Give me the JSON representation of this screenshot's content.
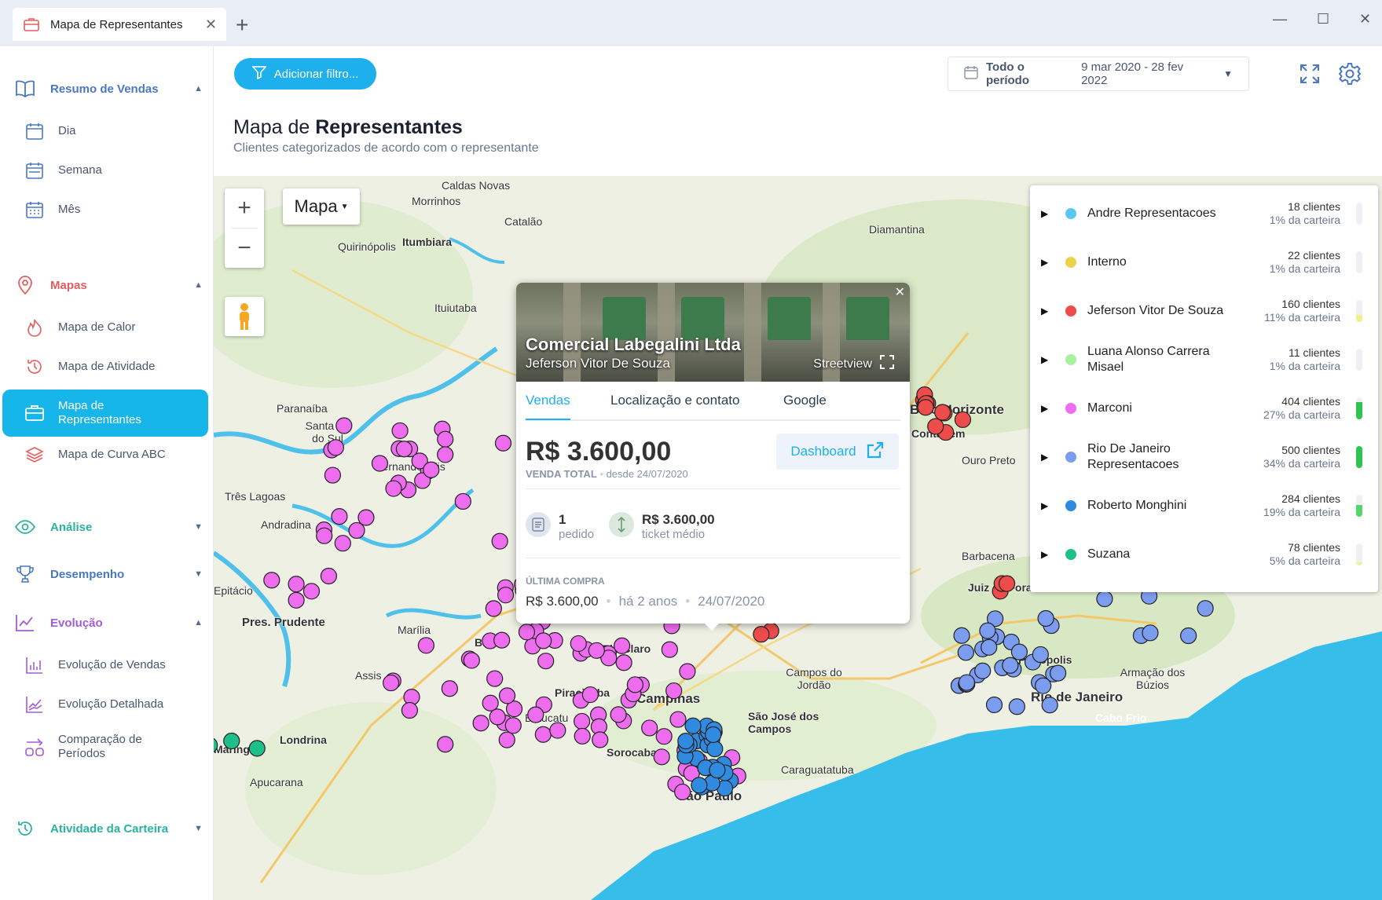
{
  "tab": {
    "title": "Mapa de Representantes",
    "icon": "briefcase-icon"
  },
  "sidebar": {
    "sections": [
      {
        "label": "Resumo de Vendas",
        "icon": "book-icon",
        "color": "#4a78c2",
        "expanded": true,
        "items": [
          {
            "label": "Dia",
            "icon": "calendar-day-icon"
          },
          {
            "label": "Semana",
            "icon": "calendar-week-icon"
          },
          {
            "label": "Mês",
            "icon": "calendar-month-icon"
          }
        ]
      },
      {
        "label": "Mapas",
        "icon": "map-pin-icon",
        "color": "#e85d5d",
        "expanded": true,
        "items": [
          {
            "label": "Mapa de Calor",
            "icon": "flame-icon"
          },
          {
            "label": "Mapa de Atividade",
            "icon": "history-icon"
          },
          {
            "label": "Mapa de Representantes",
            "icon": "briefcase-icon",
            "active": true
          },
          {
            "label": "Mapa de Curva ABC",
            "icon": "layers-icon"
          }
        ]
      },
      {
        "label": "Análise",
        "icon": "eye-icon",
        "color": "#2bb3a0",
        "expanded": false
      },
      {
        "label": "Desempenho",
        "icon": "trophy-icon",
        "color": "#4a78c2",
        "expanded": false
      },
      {
        "label": "Evolução",
        "icon": "trend-icon",
        "color": "#a35bd6",
        "expanded": true,
        "items": [
          {
            "label": "Evolução de Vendas",
            "icon": "bar-chart-icon"
          },
          {
            "label": "Evolução Detalhada",
            "icon": "line-chart-icon"
          },
          {
            "label": "Comparação de Períodos",
            "icon": "compare-icon"
          }
        ]
      },
      {
        "label": "Atividade da Carteira",
        "icon": "history-icon",
        "color": "#2bb3a0",
        "expanded": false
      }
    ]
  },
  "header": {
    "filter_label": "Adicionar filtro...",
    "date_label": "Todo o período",
    "date_range": "9 mar 2020 - 28 fev 2022",
    "title_prefix": "Mapa de ",
    "title_bold": "Representantes",
    "subtitle": "Clientes categorizados de acordo com o representante"
  },
  "map": {
    "type_label": "Mapa",
    "places": [
      "Caldas Novas",
      "Morrinhos",
      "Catalão",
      "Itumbiara",
      "Quirinópolis",
      "Diamantina",
      "Ituiutaba",
      "Paranaíba",
      "Santa Fé do Sul",
      "Fernandópolis",
      "Três Lagoas",
      "Andradina",
      "Epitácio",
      "Pres. Prudente",
      "Assis",
      "Marília",
      "Bauru",
      "Rio Claro",
      "Piracicaba",
      "Campinas",
      "Botucatu",
      "Sorocaba",
      "São Paulo",
      "São José dos Campos",
      "Campos do Jordão",
      "Caraguatatuba",
      "Londrina",
      "Maringá",
      "Apucarana",
      "Juiz de Fora",
      "Belo Horizonte",
      "Contagem",
      "Ouro Preto",
      "Barbacena",
      "Rio de Janeiro",
      "Petrópolis",
      "Armação dos Búzios",
      "Cabo Frio"
    ]
  },
  "popup": {
    "company": "Comercial Labegalini Ltda",
    "rep": "Jeferson Vitor De Souza",
    "streetview": "Streetview",
    "tabs": [
      "Vendas",
      "Localização e contato",
      "Google"
    ],
    "total": "R$ 3.600,00",
    "total_label": "VENDA TOTAL",
    "since": "desde 24/07/2020",
    "dashboard": "Dashboard",
    "orders_value": "1",
    "orders_label": "pedido",
    "ticket_value": "R$ 3.600,00",
    "ticket_label": "ticket médio",
    "last_label": "ÚLTIMA COMPRA",
    "last_value": "R$ 3.600,00",
    "last_ago": "há 2 anos",
    "last_date": "24/07/2020"
  },
  "legend": [
    {
      "name": "Andre Representacoes",
      "color": "#5bc8f2",
      "clients": "18 clientes",
      "share": "1% da carteira",
      "pct": 1,
      "bar_color": "#eef0f4"
    },
    {
      "name": "Interno",
      "color": "#ecd34a",
      "clients": "22 clientes",
      "share": "1% da carteira",
      "pct": 1,
      "bar_color": "#eef0f4"
    },
    {
      "name": "Jeferson Vitor De Souza",
      "color": "#ee4b4b",
      "clients": "160 clientes",
      "share": "11% da carteira",
      "pct": 11,
      "bar_color": "#eef28a"
    },
    {
      "name": "Luana Alonso Carrera Misael",
      "color": "#a7f2a0",
      "clients": "11 clientes",
      "share": "1% da carteira",
      "pct": 1,
      "bar_color": "#eef0f4"
    },
    {
      "name": "Marconi",
      "color": "#ee6cee",
      "clients": "404 clientes",
      "share": "27% da carteira",
      "pct": 27,
      "bar_color": "#2fc44f"
    },
    {
      "name": "Rio De Janeiro Representacoes",
      "color": "#7c9cf0",
      "clients": "500 clientes",
      "share": "34% da carteira",
      "pct": 34,
      "bar_color": "#2fc44f"
    },
    {
      "name": "Roberto Monghini",
      "color": "#2f8ae0",
      "clients": "284 clientes",
      "share": "19% da carteira",
      "pct": 19,
      "bar_color": "#52d66d"
    },
    {
      "name": "Suzana",
      "color": "#1fbf8a",
      "clients": "78 clientes",
      "share": "5% da carteira",
      "pct": 5,
      "bar_color": "#eef2a0"
    }
  ]
}
